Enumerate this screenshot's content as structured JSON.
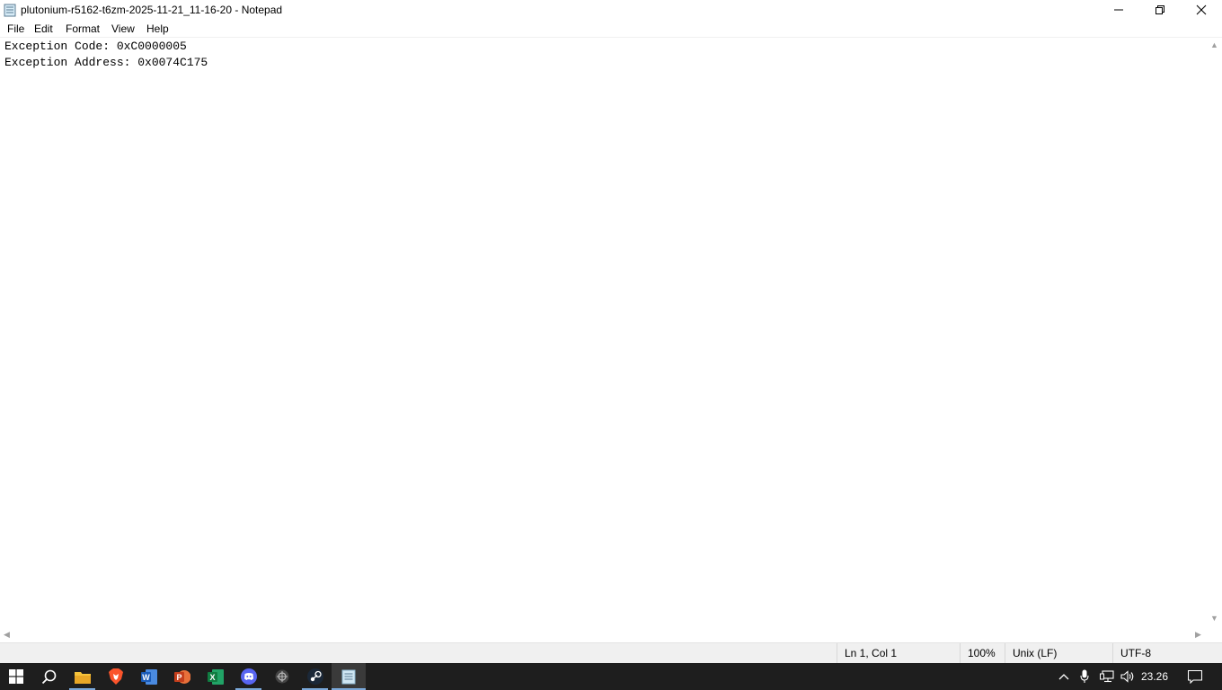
{
  "window": {
    "title": "plutonium-r5162-t6zm-2025-11-21_11-16-20 - Notepad"
  },
  "menu": {
    "file": "File",
    "edit": "Edit",
    "format": "Format",
    "view": "View",
    "help": "Help"
  },
  "document": {
    "lines": [
      "Exception Code: 0xC0000005",
      "Exception Address: 0x0074C175"
    ]
  },
  "status": {
    "position": "Ln 1, Col 1",
    "zoom": "100%",
    "line_ending": "Unix (LF)",
    "encoding": "UTF-8"
  },
  "taskbar": {
    "apps": [
      "start-icon",
      "search-icon",
      "file-explorer-icon",
      "brave-browser-icon",
      "word-icon",
      "powerpoint-icon",
      "excel-icon",
      "discord-icon",
      "app-icon",
      "steam-icon",
      "notepad-icon"
    ],
    "clock": "23.26"
  },
  "colors": {
    "taskbar_bg": "#1e1e1e",
    "accent": "#7aa7d8"
  }
}
